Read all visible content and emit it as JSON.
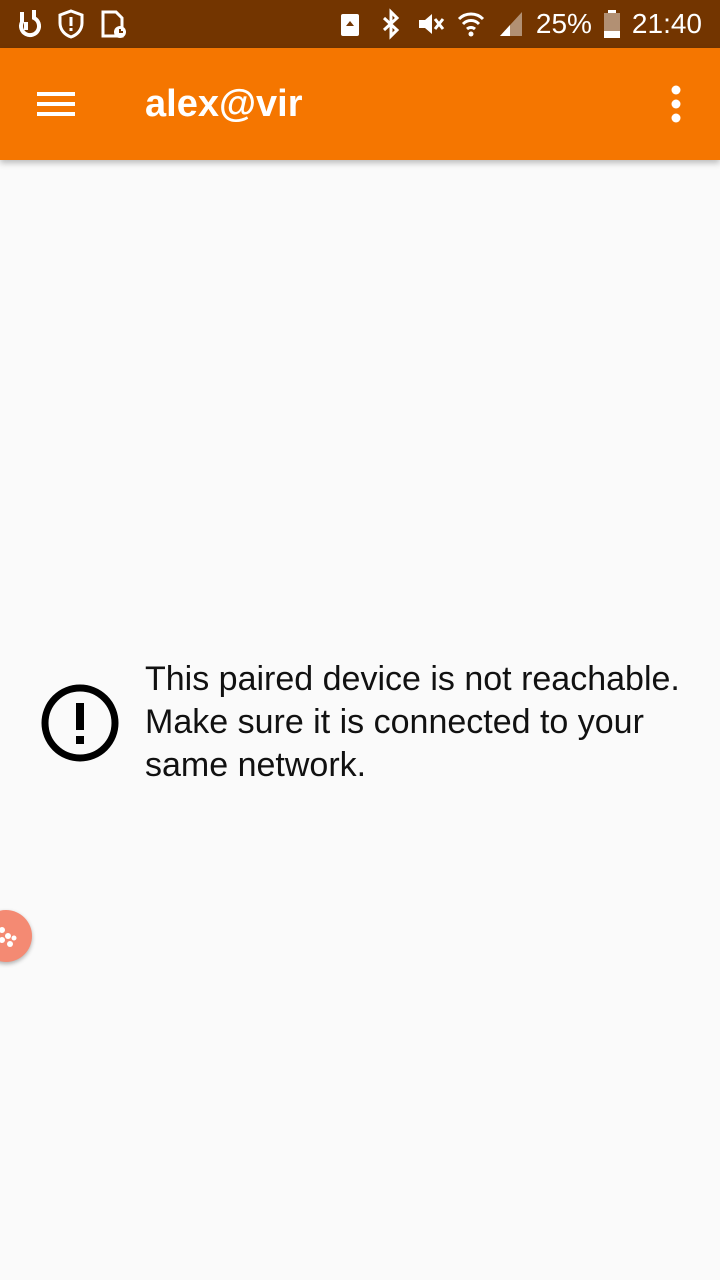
{
  "status_bar": {
    "battery_percent": "25%",
    "time": "21:40",
    "icons": [
      "app-d-icon",
      "shield-icon",
      "sim-clock-icon",
      "cloud-upload-icon",
      "bluetooth-icon",
      "mute-icon",
      "wifi-icon",
      "signal-icon",
      "battery-icon"
    ]
  },
  "toolbar": {
    "title": "alex@vir",
    "menu_icon": "hamburger-menu-icon",
    "overflow_icon": "more-vert-icon",
    "color": "#f57600"
  },
  "message": {
    "icon": "alert-circle-icon",
    "text": "This paired device is not reachable. Make sure it is connected to your same network."
  },
  "floating": {
    "icon": "floating-bubble-icon",
    "color": "#f48a73"
  }
}
